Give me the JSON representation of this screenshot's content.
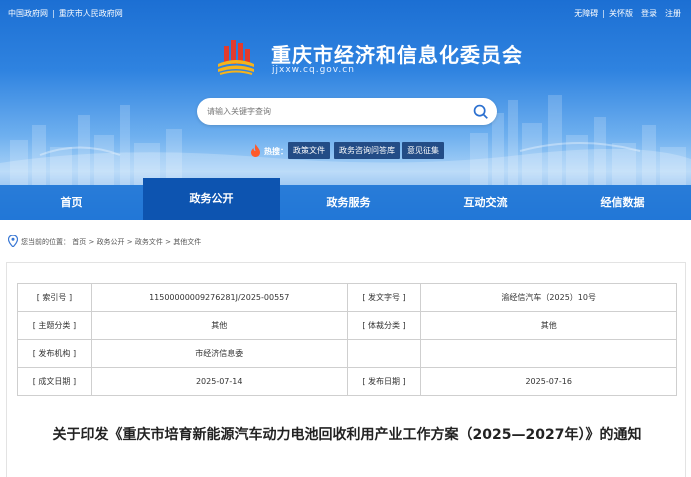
{
  "topbar": {
    "left_links": [
      "中国政府网",
      "重庆市人民政府网"
    ],
    "right_links": [
      "无障碍",
      "关怀版",
      "登录",
      "注册"
    ]
  },
  "site": {
    "title": "重庆市经济和信息化委员会",
    "domain": "jjxxw.cq.gov.cn"
  },
  "search": {
    "placeholder": "请输入关键字查询",
    "icon": "search-icon"
  },
  "hot": {
    "label": "热搜：",
    "tags": [
      "政策文件",
      "政务咨询问答库",
      "意见征集"
    ]
  },
  "nav": {
    "items": [
      "首页",
      "政务公开",
      "政务服务",
      "互动交流",
      "经信数据"
    ],
    "active_index": 1
  },
  "breadcrumb": {
    "prefix": "您当前的位置：",
    "path": [
      "首页",
      "政务公开",
      "政务文件",
      "其他文件"
    ]
  },
  "meta": {
    "rows": [
      {
        "k1": "[ 索引号 ]",
        "v1": "11500000009276281J/2025-00557",
        "k2": "[ 发文字号 ]",
        "v2": "渝经信汽车（2025）10号"
      },
      {
        "k1": "[ 主题分类 ]",
        "v1": "其他",
        "k2": "[ 体裁分类 ]",
        "v2": "其他"
      },
      {
        "k1": "[ 发布机构 ]",
        "v1": "市经济信息委",
        "k2": "",
        "v2": ""
      },
      {
        "k1": "[ 成文日期 ]",
        "v1": "2025-07-14",
        "k2": "[ 发布日期 ]",
        "v2": "2025-07-16"
      }
    ]
  },
  "document": {
    "title": "关于印发《重庆市培育新能源汽车动力电池回收利用产业工作方案（2025—2027年）》的通知"
  },
  "colors": {
    "header_blue": "#1c6fd3",
    "nav_blue": "#2176d6",
    "nav_active": "#0d54b0",
    "tag_bg": "#234c86"
  }
}
